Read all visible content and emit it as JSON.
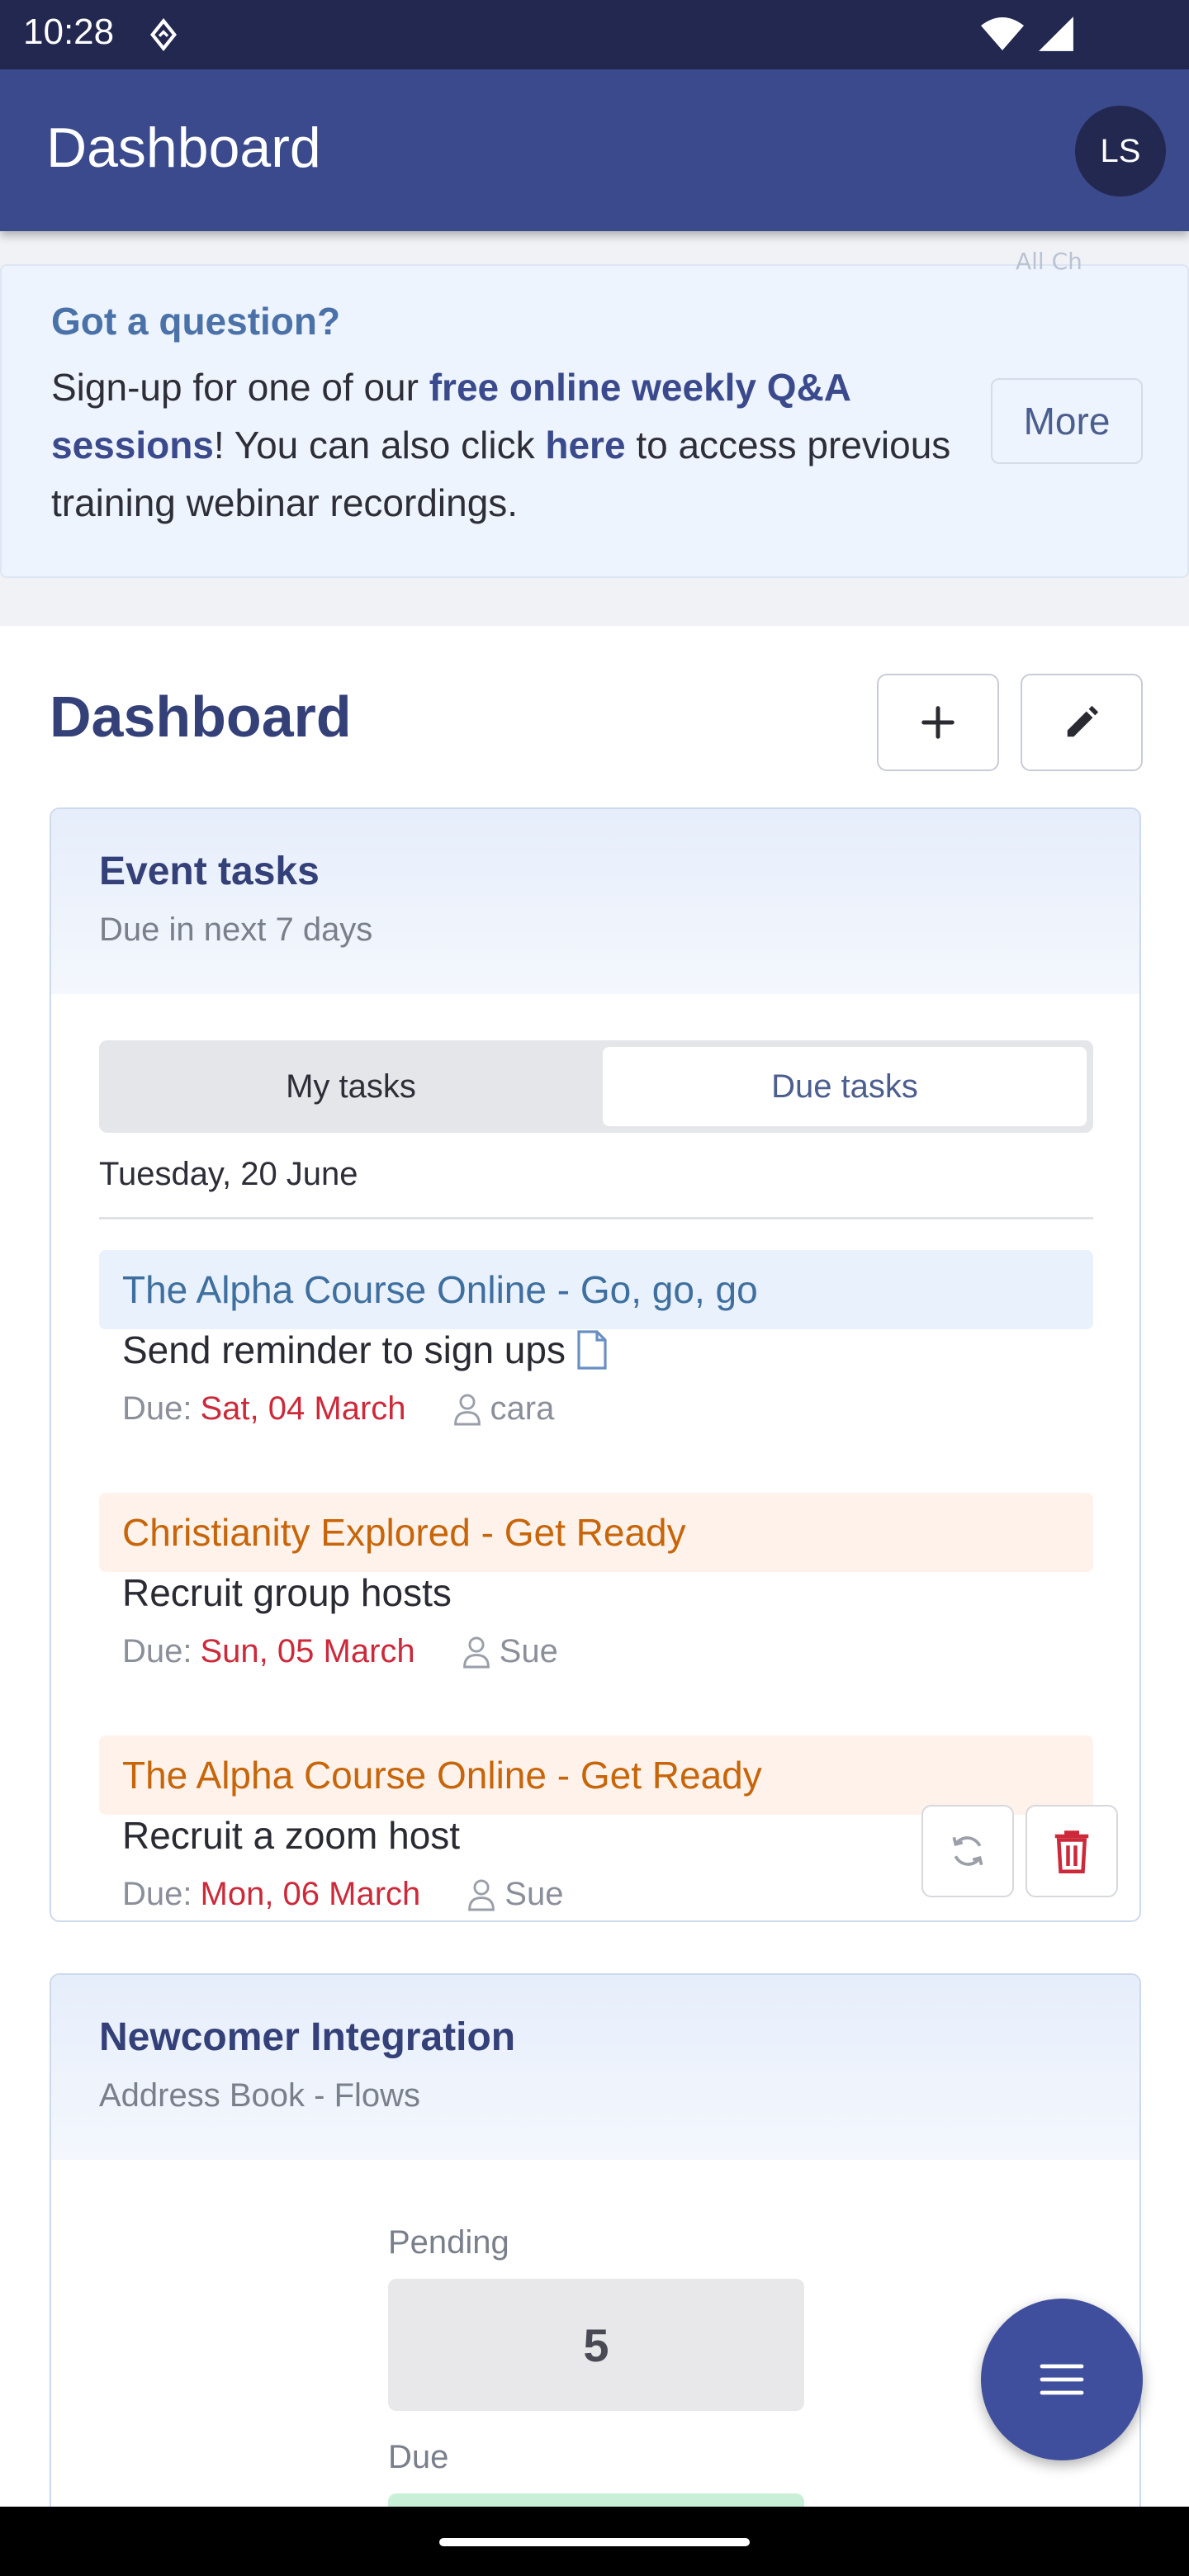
{
  "status_bar": {
    "time": "10:28"
  },
  "app_bar": {
    "title": "Dashboard",
    "avatar_initials": "LS"
  },
  "banner": {
    "peek_text": "All Ch",
    "heading": "Got a question?",
    "text_part1": "Sign-up for one of our ",
    "link1": "free online weekly Q&A sessions",
    "text_part2": "! You can also click ",
    "link2": "here",
    "text_part3": " to access previous training webinar recordings.",
    "more_label": "More"
  },
  "main": {
    "title": "Dashboard"
  },
  "event_tasks": {
    "title": "Event tasks",
    "subtitle": "Due in next 7 days",
    "tabs": [
      "My tasks",
      "Due tasks"
    ],
    "active_tab": "Due tasks",
    "date_header": "Tuesday, 20 June",
    "due_label": "Due:",
    "groups": [
      {
        "name": "The Alpha Course Online - Go, go, go",
        "color": "blue",
        "task": "Send reminder to sign ups",
        "due": "Sat, 04 March",
        "assignee": "cara"
      },
      {
        "name": "Christianity Explored - Get Ready",
        "color": "orange",
        "task": "Recruit group hosts",
        "due": "Sun, 05 March",
        "assignee": "Sue"
      },
      {
        "name": "The Alpha Course Online - Get Ready",
        "color": "orange",
        "task": "Recruit a zoom host",
        "due": "Mon, 06 March",
        "assignee": "Sue"
      }
    ]
  },
  "newcomer": {
    "title": "Newcomer Integration",
    "subtitle": "Address Book - Flows",
    "pending_label": "Pending",
    "pending_value": "5",
    "due_label": "Due"
  },
  "colors": {
    "app_bar": "#3a4a8c",
    "status_bar": "#232850",
    "due_date": "#cc2a3a",
    "group_orange": "#c7650a",
    "group_blue": "#3e6f9f"
  }
}
